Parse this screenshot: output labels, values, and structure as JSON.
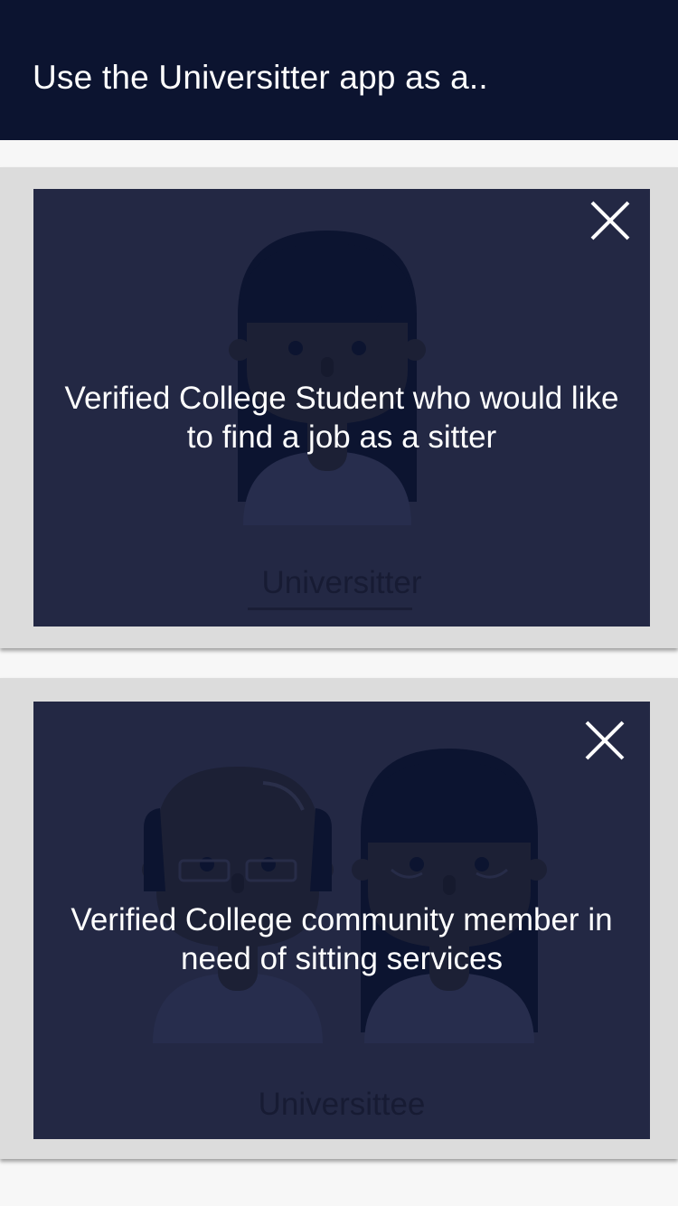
{
  "header": {
    "title": "Use the Universitter app as a.."
  },
  "options": [
    {
      "role": "Universitter",
      "description": "Verified College Student who would like to find a job as a sitter",
      "close_icon": "close-icon",
      "illustration": "student-avatar-icon"
    },
    {
      "role": "Universittee",
      "description": "Verified College community member in need of sitting services",
      "close_icon": "close-icon",
      "illustration": "community-members-avatar-icon"
    }
  ],
  "colors": {
    "header_bg": "#0c1430",
    "card_bg": "#dcdcdc",
    "panel_overlay": "#232844",
    "text_light": "#ffffff",
    "text_dark": "#171b33"
  }
}
